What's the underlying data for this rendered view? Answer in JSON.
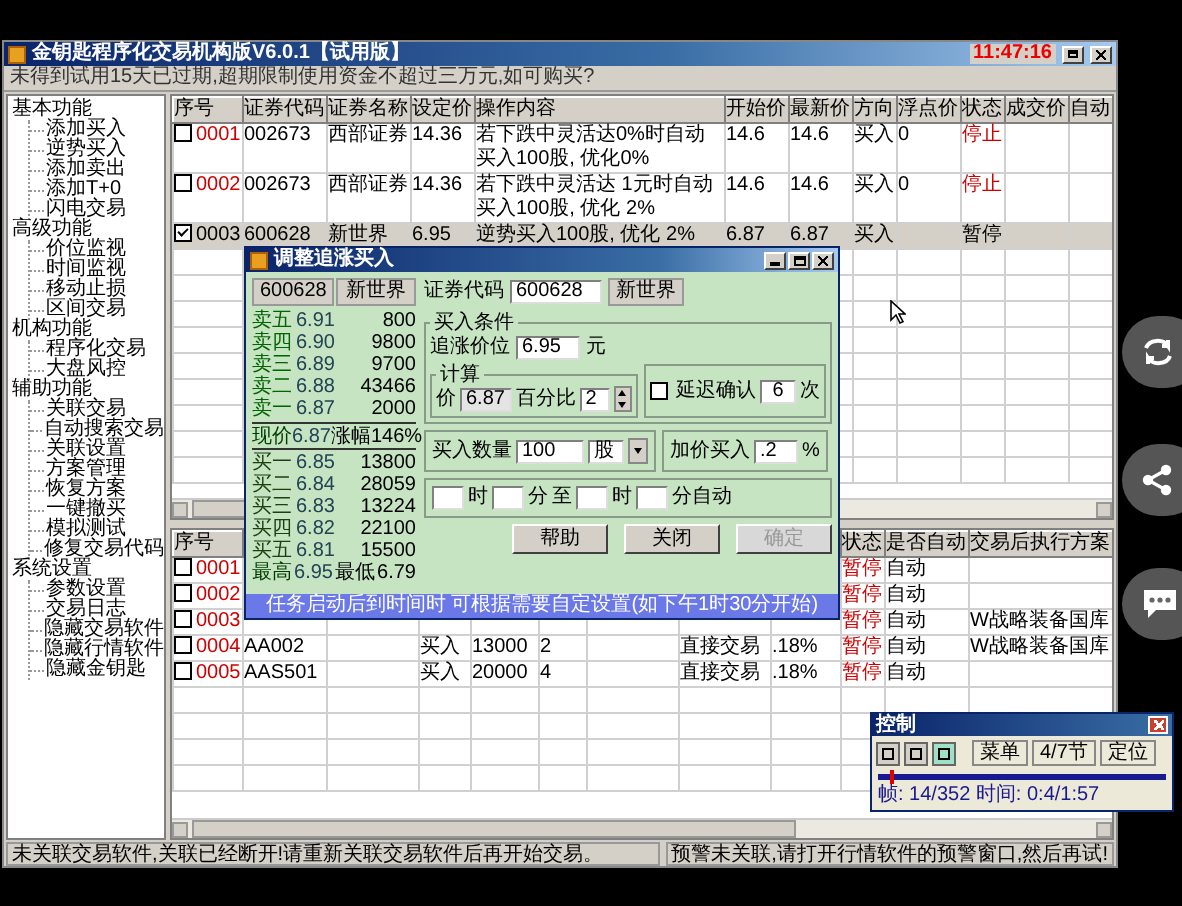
{
  "window": {
    "title": "金钥匙程序化交易机构版V6.0.1【试用版】",
    "clock": "11:47:16"
  },
  "notice": "未得到试用15天已过期,超期限制使用资金不超过三万元,如可购买?",
  "sidebar": [
    {
      "label": "基本功能",
      "children": [
        {
          "label": "添加买入"
        },
        {
          "label": "逆势买入"
        },
        {
          "label": "添加卖出"
        },
        {
          "label": "添加T+0"
        },
        {
          "label": "闪电交易"
        }
      ]
    },
    {
      "label": "高级功能",
      "children": [
        {
          "label": "价位监视"
        },
        {
          "label": "时间监视"
        },
        {
          "label": "移动止损"
        },
        {
          "label": "区间交易"
        }
      ]
    },
    {
      "label": "机构功能",
      "children": [
        {
          "label": "程序化交易"
        },
        {
          "label": "大盘风控"
        }
      ]
    },
    {
      "label": "辅助功能",
      "children": [
        {
          "label": "关联交易"
        },
        {
          "label": "自动搜索交易"
        },
        {
          "label": "关联设置"
        },
        {
          "label": "方案管理"
        },
        {
          "label": "恢复方案"
        },
        {
          "label": "一键撤买"
        },
        {
          "label": "模拟测试"
        },
        {
          "label": "修复交易代码"
        }
      ]
    },
    {
      "label": "系统设置",
      "children": [
        {
          "label": "参数设置"
        },
        {
          "label": "交易日志"
        },
        {
          "label": "隐藏交易软件"
        },
        {
          "label": "隐藏行情软件"
        },
        {
          "label": "隐藏金钥匙"
        }
      ]
    }
  ],
  "top_table": {
    "columns": [
      "序号",
      "证券代码",
      "证券名称",
      "设定价",
      "操作内容",
      "开始价",
      "最新价",
      "方向",
      "浮点价",
      "状态",
      "成交价",
      "自动"
    ],
    "rows": [
      {
        "checked": false,
        "selected": false,
        "seq": "0001",
        "code": "002673",
        "name": "西部证券",
        "price": "14.36",
        "action": "若下跌中灵活达0%时自动买入100股, 优化0%",
        "open": "14.6",
        "last": "14.6",
        "side": "买入",
        "float": "0",
        "status": "停止"
      },
      {
        "checked": false,
        "selected": false,
        "seq": "0002",
        "code": "002673",
        "name": "西部证券",
        "price": "14.36",
        "action": "若下跌中灵活达 1元时自动买入100股, 优化 2%",
        "open": "14.6",
        "last": "14.6",
        "side": "买入",
        "float": "0",
        "status": "停止"
      },
      {
        "checked": true,
        "selected": true,
        "seq": "0003",
        "code": "600628",
        "name": "新世界",
        "price": "6.95",
        "action": "逆势买入100股, 优化 2%",
        "open": "6.87",
        "last": "6.87",
        "side": "买入",
        "status": "暂停"
      }
    ]
  },
  "bottom_table": {
    "columns": {
      "seq": "序号",
      "status": "状态",
      "auto": "是否自动",
      "plan": "交易后执行方案"
    },
    "rows": [
      {
        "checked": false,
        "seq": "0001",
        "status": "暂停",
        "auto": "自动"
      },
      {
        "checked": false,
        "seq": "0002",
        "status": "暂停",
        "auto": "自动"
      },
      {
        "checked": false,
        "seq": "0003",
        "status": "暂停",
        "auto": "自动",
        "plan": "W战略装备国库"
      },
      {
        "checked": false,
        "seq": "0004",
        "code": "AA002",
        "side": "买入",
        "qty": "13000",
        "count": "2",
        "type": "直接交易",
        "rate": ".18%",
        "status": "暂停",
        "auto": "自动",
        "plan": "W战略装备国库"
      },
      {
        "checked": false,
        "seq": "0005",
        "code": "AAS501",
        "side": "买入",
        "qty": "20000",
        "count": "4",
        "type": "直接交易",
        "rate": ".18%",
        "status": "暂停",
        "auto": "自动"
      }
    ]
  },
  "dialog": {
    "title": "调整追涨买入",
    "quote": {
      "code": "600628",
      "name": "新世界",
      "asks": [
        {
          "label": "卖五",
          "price": "6.91",
          "volume": "800"
        },
        {
          "label": "卖四",
          "price": "6.90",
          "volume": "9800"
        },
        {
          "label": "卖三",
          "price": "6.89",
          "volume": "9700"
        },
        {
          "label": "卖二",
          "price": "6.88",
          "volume": "43466"
        },
        {
          "label": "卖一",
          "price": "6.87",
          "volume": "2000"
        }
      ],
      "last": {
        "label": "现价",
        "price": "6.87",
        "change_label": "涨幅",
        "change": "146%"
      },
      "bids": [
        {
          "label": "买一",
          "price": "6.85",
          "volume": "13800"
        },
        {
          "label": "买二",
          "price": "6.84",
          "volume": "28059"
        },
        {
          "label": "买三",
          "price": "6.83",
          "volume": "13224"
        },
        {
          "label": "买四",
          "price": "6.82",
          "volume": "22100"
        },
        {
          "label": "买五",
          "price": "6.81",
          "volume": "15500"
        }
      ],
      "range": {
        "high_label": "最高",
        "high": "6.95",
        "low_label": "最低",
        "low": "6.79"
      }
    },
    "code_label": "证券代码",
    "code": "600628",
    "name": "新世界",
    "condition": {
      "legend": "买入条件",
      "price_label": "追涨价位",
      "price": "6.95",
      "unit": "元"
    },
    "calc": {
      "legend": "计算",
      "price_label": "价",
      "price": "6.87",
      "pct_label": "百分比",
      "pct": "2"
    },
    "delay": {
      "checked": false,
      "label": "延迟确认",
      "value": "6",
      "unit": "次"
    },
    "qty": {
      "label": "买入数量",
      "value": "100",
      "unit": "股"
    },
    "markup": {
      "label": "加价买入",
      "value": ".2",
      "unit": "%"
    },
    "schedule": {
      "hour_unit": "时",
      "min_unit": "分",
      "to": "至",
      "end_hour_unit": "时",
      "end_suffix": "分自动"
    },
    "buttons": [
      {
        "label": "帮助",
        "disabled": false
      },
      {
        "label": "关闭",
        "disabled": false
      },
      {
        "label": "确定",
        "disabled": true
      }
    ],
    "hint": "任务启动后到时间时 可根据需要自定设置(如下午1时30分开始)"
  },
  "status_bar": [
    "未关联交易软件,关联已经断开!请重新关联交易软件后再开始交易。",
    "预警未关联,请打开行情软件的预警窗口,然后再试!"
  ],
  "player": {
    "title": "控制",
    "buttons": [
      "菜单",
      "4/7节",
      "定位"
    ],
    "level": 0.04,
    "info": "帧: 14/352 时间: 0:4/1:57"
  }
}
